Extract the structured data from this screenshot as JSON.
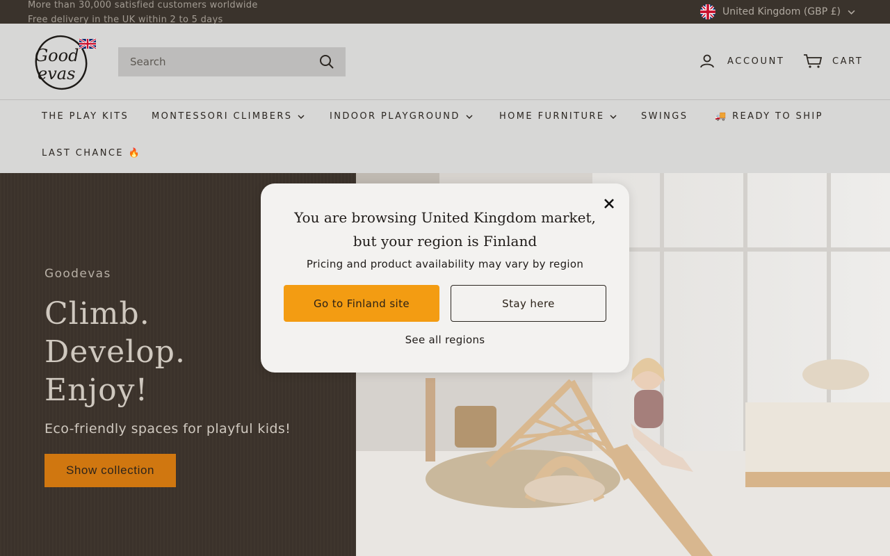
{
  "announcement": {
    "line1": "More than 30,000 satisfied customers worldwide",
    "line2": "Free delivery in the UK within 2 to 5 days"
  },
  "region_selector": {
    "label": "United Kingdom (GBP £)",
    "flag_icon": "uk-flag-icon"
  },
  "header": {
    "logo_text": "Good evas",
    "search": {
      "placeholder": "Search"
    },
    "account_label": "ACCOUNT",
    "cart_label": "CART"
  },
  "nav": {
    "items": [
      {
        "label": "THE PLAY KITS",
        "dropdown": false
      },
      {
        "label": "MONTESSORI CLIMBERS",
        "dropdown": true
      },
      {
        "label": "INDOOR PLAYGROUND",
        "dropdown": true
      },
      {
        "label": "HOME FURNITURE",
        "dropdown": true
      },
      {
        "label": "SWINGS",
        "dropdown": false
      },
      {
        "label": "🚚 READY TO SHIP",
        "dropdown": false
      },
      {
        "label": "LAST CHANCE 🔥",
        "dropdown": false
      }
    ]
  },
  "hero": {
    "eyebrow": "Goodevas",
    "headline_lines": [
      "Climb.",
      "Develop.",
      "Enjoy!"
    ],
    "subline": "Eco-friendly spaces for playful kids!",
    "cta_label": "Show collection"
  },
  "modal": {
    "title_line1": "You are browsing United Kingdom market,",
    "title_line2": "but your region is Finland",
    "subtitle": "Pricing and product availability may vary by region",
    "primary_button": "Go to Finland site",
    "secondary_button": "Stay here",
    "link": "See all regions"
  },
  "colors": {
    "topbar_bg": "#3a332c",
    "header_bg": "#d7d7d6",
    "hero_left_bg": "#3d342c",
    "cta_bg": "#d07710",
    "modal_primary": "#f39c12"
  }
}
